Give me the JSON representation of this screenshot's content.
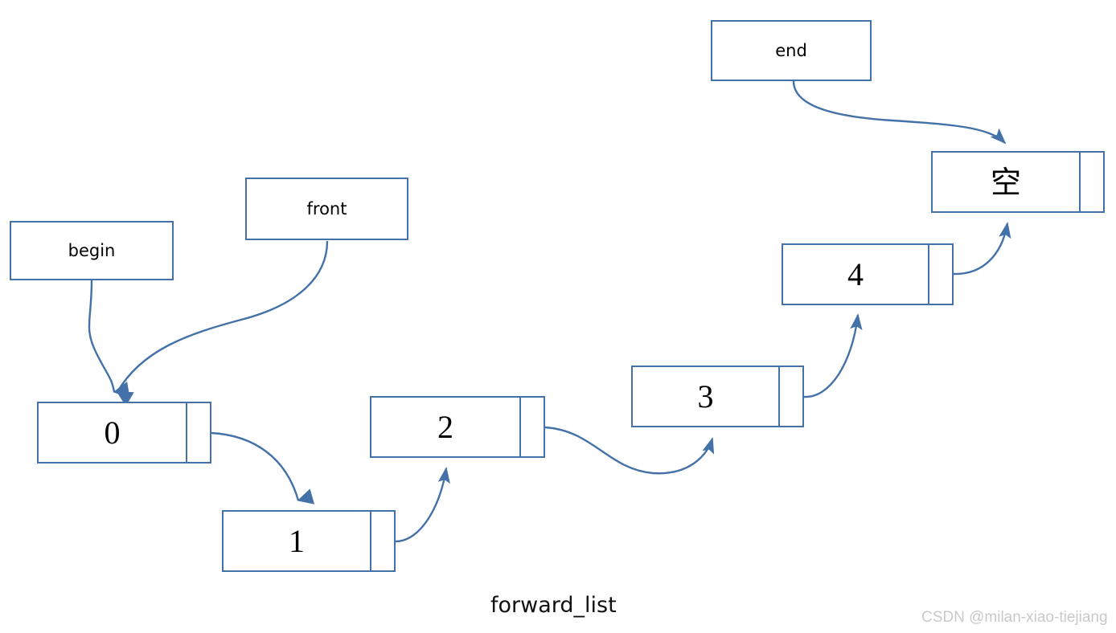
{
  "diagram": {
    "caption": "forward_list",
    "watermark": "CSDN @milan-xiao-tiejiang",
    "colors": {
      "stroke": "#4472a8",
      "background": "#ffffff",
      "text": "#000000",
      "watermark": "#c9c9c9"
    },
    "label_boxes": [
      {
        "id": "begin",
        "label": "begin"
      },
      {
        "id": "front",
        "label": "front"
      },
      {
        "id": "end",
        "label": "end"
      }
    ],
    "nodes": [
      {
        "id": "node-0",
        "value": "0"
      },
      {
        "id": "node-1",
        "value": "1"
      },
      {
        "id": "node-2",
        "value": "2"
      },
      {
        "id": "node-3",
        "value": "3"
      },
      {
        "id": "node-4",
        "value": "4"
      },
      {
        "id": "node-null",
        "value": "空"
      }
    ],
    "edges": [
      {
        "from": "begin",
        "to": "node-0"
      },
      {
        "from": "front",
        "to": "node-0"
      },
      {
        "from": "node-0",
        "to": "node-1"
      },
      {
        "from": "node-1",
        "to": "node-2"
      },
      {
        "from": "node-2",
        "to": "node-3"
      },
      {
        "from": "node-3",
        "to": "node-4"
      },
      {
        "from": "node-4",
        "to": "node-null"
      },
      {
        "from": "end",
        "to": "node-null"
      }
    ]
  }
}
